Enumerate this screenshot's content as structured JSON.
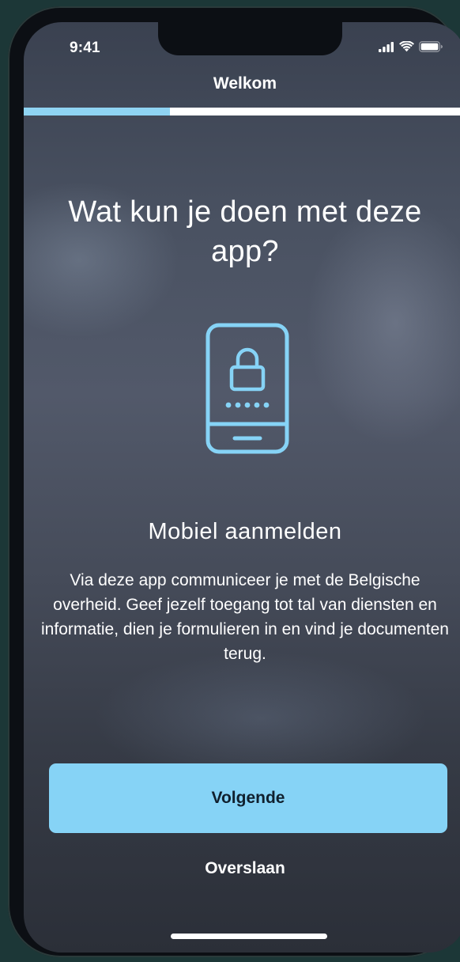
{
  "status_bar": {
    "time": "9:41",
    "icons": [
      "cellular-signal-icon",
      "wifi-icon",
      "battery-icon"
    ]
  },
  "nav": {
    "title": "Welkom"
  },
  "progress": {
    "fraction": 0.33
  },
  "onboarding": {
    "headline": "Wat kun je doen met deze app?",
    "illustration": "phone-lock-icon",
    "feature_title": "Mobiel aanmelden",
    "feature_description": "Via deze app communiceer je met de Belgische overheid. Geef jezelf toegang tot tal van diensten en informatie, dien je formulieren in en vind je documenten terug."
  },
  "actions": {
    "next_label": "Volgende",
    "skip_label": "Overslaan"
  },
  "colors": {
    "accent": "#86d3f6",
    "progress_fill": "#8fd4f3",
    "progress_track": "#ffffff",
    "button_text": "#10202e"
  }
}
